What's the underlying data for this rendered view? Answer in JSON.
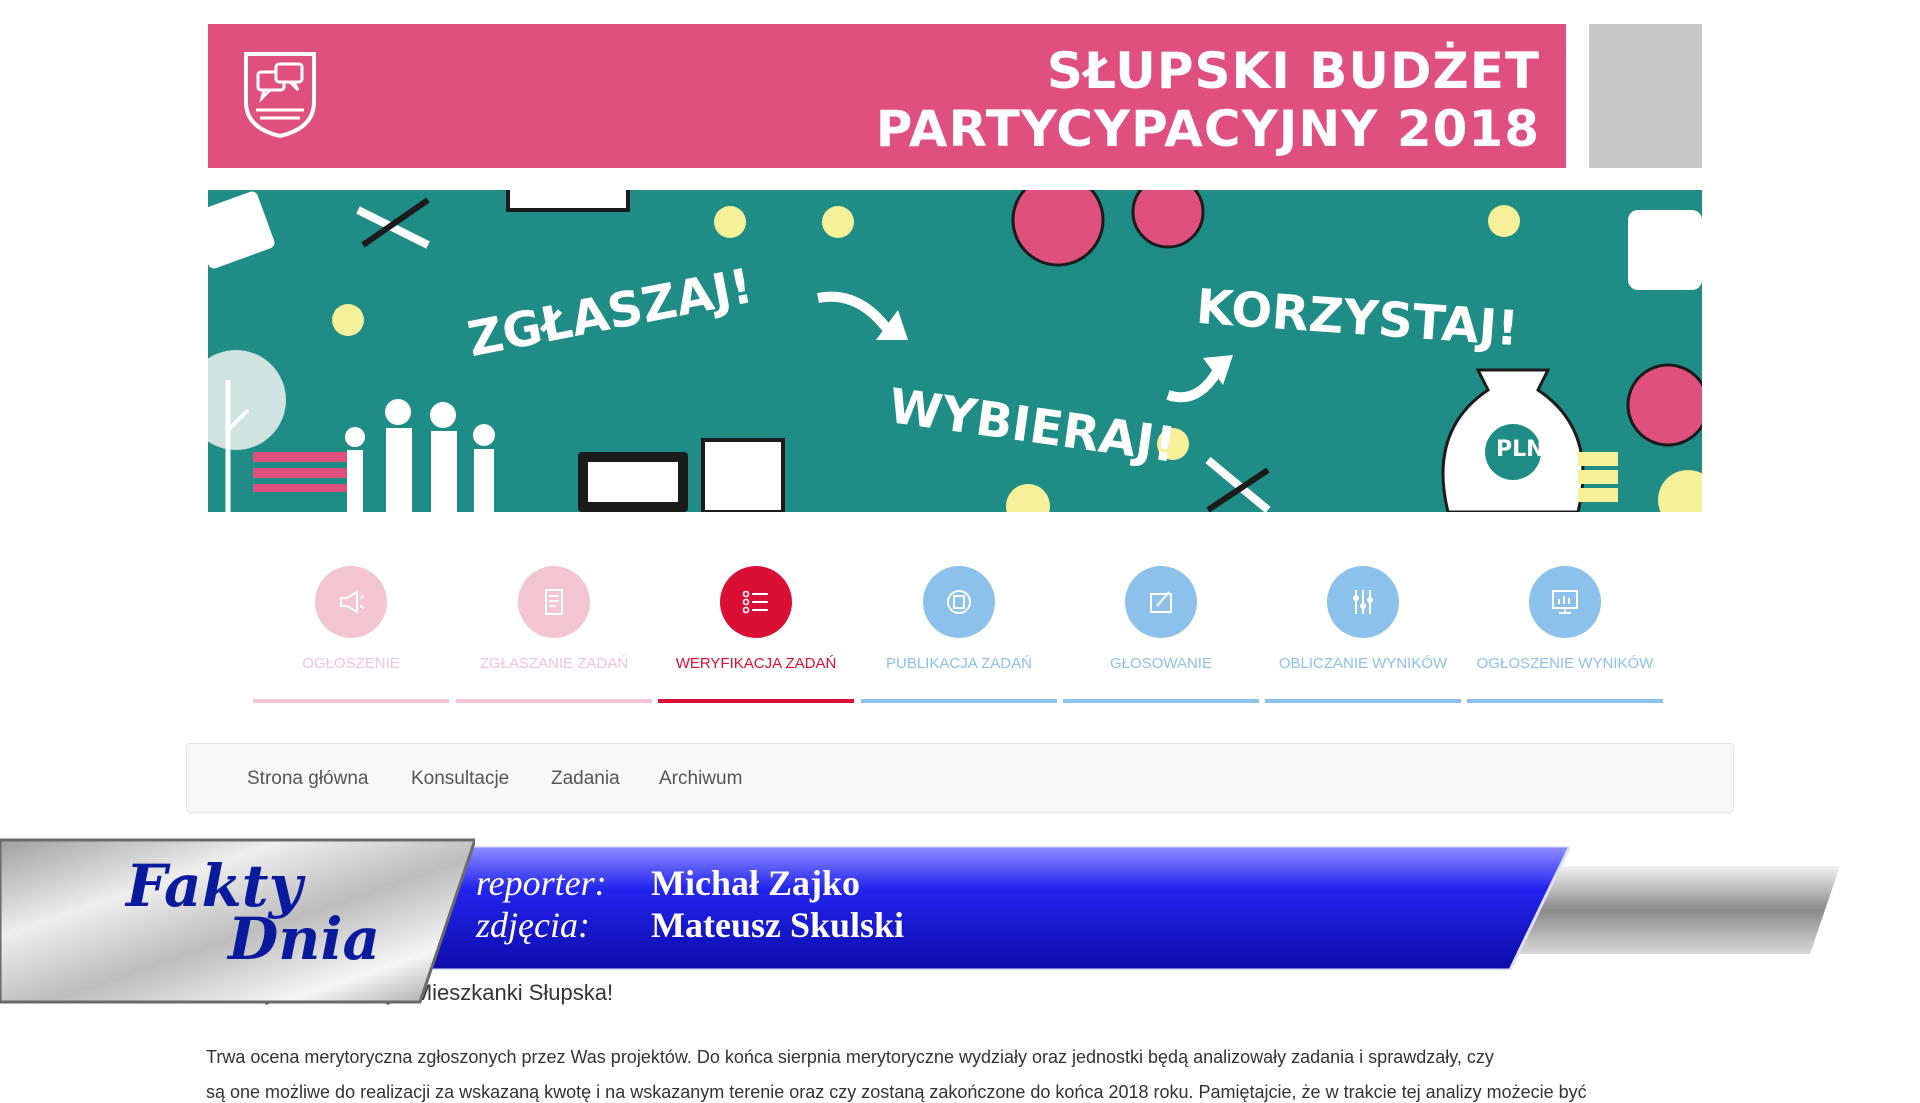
{
  "header": {
    "title_line1": "SŁUPSKI BUDŻET",
    "title_line2": "PARTYCYPACYJNY 2018",
    "logo_icon": "speech-bubbles-shield-icon",
    "background_color": "#e0507e"
  },
  "banner": {
    "word1": "ZGŁASZAJ!",
    "word2": "WYBIERAJ!",
    "word3": "KORZYSTAJ!",
    "money_label": "PLN",
    "background_color": "#208c86"
  },
  "phases": [
    {
      "label": "OGŁOSZENIE",
      "icon": "megaphone-icon",
      "state": "done"
    },
    {
      "label": "ZGŁASZANIE ZADAŃ",
      "icon": "document-icon",
      "state": "done"
    },
    {
      "label": "WERYFIKACJA ZADAŃ",
      "icon": "checklist-icon",
      "state": "active"
    },
    {
      "label": "PUBLIKACJA ZADAŃ",
      "icon": "publish-icon",
      "state": "upcoming"
    },
    {
      "label": "GŁOSOWANIE",
      "icon": "vote-icon",
      "state": "upcoming"
    },
    {
      "label": "OBLICZANIE WYNIKÓW",
      "icon": "abacus-icon",
      "state": "upcoming"
    },
    {
      "label": "OGŁOSZENIE WYNIKÓW",
      "icon": "chart-screen-icon",
      "state": "upcoming"
    }
  ],
  "phase_colors": {
    "done": "#f3c4d2",
    "active": "#d90f36",
    "upcoming": "#8cc1ec"
  },
  "nav": {
    "items": [
      "Strona główna",
      "Konsultacje",
      "Zadania",
      "Archiwum"
    ]
  },
  "content": {
    "greeting": "Drodzy Mieszkańcy i Mieszkanki Słupska!",
    "paragraph1": "Trwa ocena merytoryczna zgłoszonych przez Was projektów. Do końca sierpnia merytoryczne wydziały oraz jednostki będą analizowały zadania i sprawdzały, czy",
    "paragraph2": "są one możliwe do realizacji za wskazaną kwotę i na wskazanym terenie oraz czy zostaną zakończone do końca 2018 roku. Pamiętajcie, że w trakcie tej analizy możecie być"
  },
  "overlay": {
    "brand_line1": "Fakty",
    "brand_line2": "Dnia",
    "reporter_label": "reporter:",
    "reporter_name": "Michał Zajko",
    "photo_label": "zdjęcia:",
    "photo_name": "Mateusz Skulski"
  }
}
